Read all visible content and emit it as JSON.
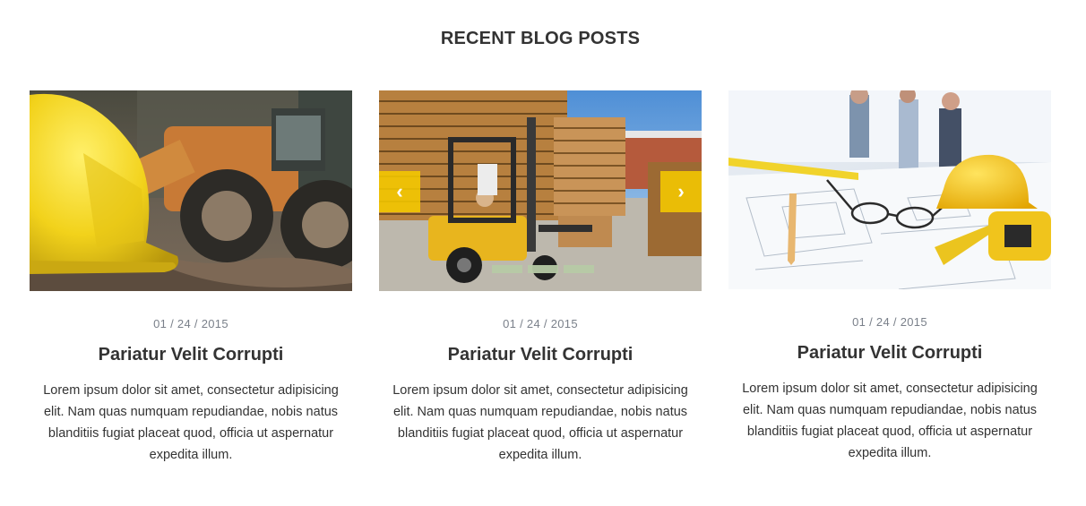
{
  "section": {
    "title": "RECENT BLOG POSTS"
  },
  "posts": [
    {
      "date": "01 / 24 / 2015",
      "title": "Pariatur Velit Corrupti",
      "excerpt": "Lorem ipsum dolor sit amet, consectetur adipisicing elit. Nam quas numquam repudiandae, nobis natus blanditiis fugiat placeat quod, officia ut aspernatur expedita illum.",
      "image": "hard-hat-and-excavator-photo"
    },
    {
      "date": "01 / 24 / 2015",
      "title": "Pariatur Velit Corrupti",
      "excerpt": "Lorem ipsum dolor sit amet, consectetur adipisicing elit. Nam quas numquam repudiandae, nobis natus blanditiis fugiat placeat quod, officia ut aspernatur expedita illum.",
      "image": "forklift-with-pallets-photo",
      "slider": {
        "prev_icon": "‹",
        "next_icon": "›",
        "slides": 3
      }
    },
    {
      "date": "01 / 24 / 2015",
      "title": "Pariatur Velit Corrupti",
      "excerpt": "Lorem ipsum dolor sit amet, consectetur adipisicing elit. Nam quas numquam repudiandae, nobis natus blanditiis fugiat placeat quod, officia ut aspernatur expedita illum.",
      "image": "blueprints-glasses-and-team-photo"
    }
  ],
  "colors": {
    "accent": "#f5c800",
    "text": "#333333",
    "date": "#7a808a",
    "slider_dot": "#b6c9a5"
  }
}
